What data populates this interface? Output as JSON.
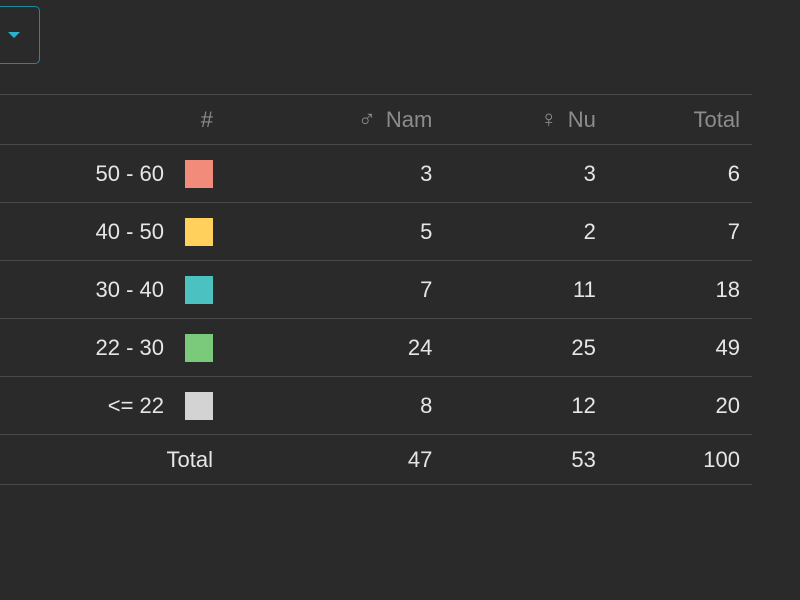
{
  "header": {
    "hash": "#",
    "male_symbol": "♂",
    "male": "Nam",
    "female_symbol": "♀",
    "female": "Nu",
    "total": "Total"
  },
  "rows": [
    {
      "range": "50 - 60",
      "color": "#f28b7a",
      "nam": "3",
      "nu": "3",
      "total": "6"
    },
    {
      "range": "40 - 50",
      "color": "#ffd15c",
      "nam": "5",
      "nu": "2",
      "total": "7"
    },
    {
      "range": "30 - 40",
      "color": "#4cc1c1",
      "nam": "7",
      "nu": "11",
      "total": "18"
    },
    {
      "range": "22 - 30",
      "color": "#7bc97a",
      "nam": "24",
      "nu": "25",
      "total": "49"
    },
    {
      "range": "<= 22",
      "color": "#d3d3d3",
      "nam": "8",
      "nu": "12",
      "total": "20"
    }
  ],
  "footer": {
    "label": "Total",
    "nam": "47",
    "nu": "53",
    "total": "100"
  },
  "colors": {
    "accent": "#2ab3cf",
    "background": "#2a2a2a"
  },
  "icons": {
    "dropdown": "chevron-down-icon"
  }
}
